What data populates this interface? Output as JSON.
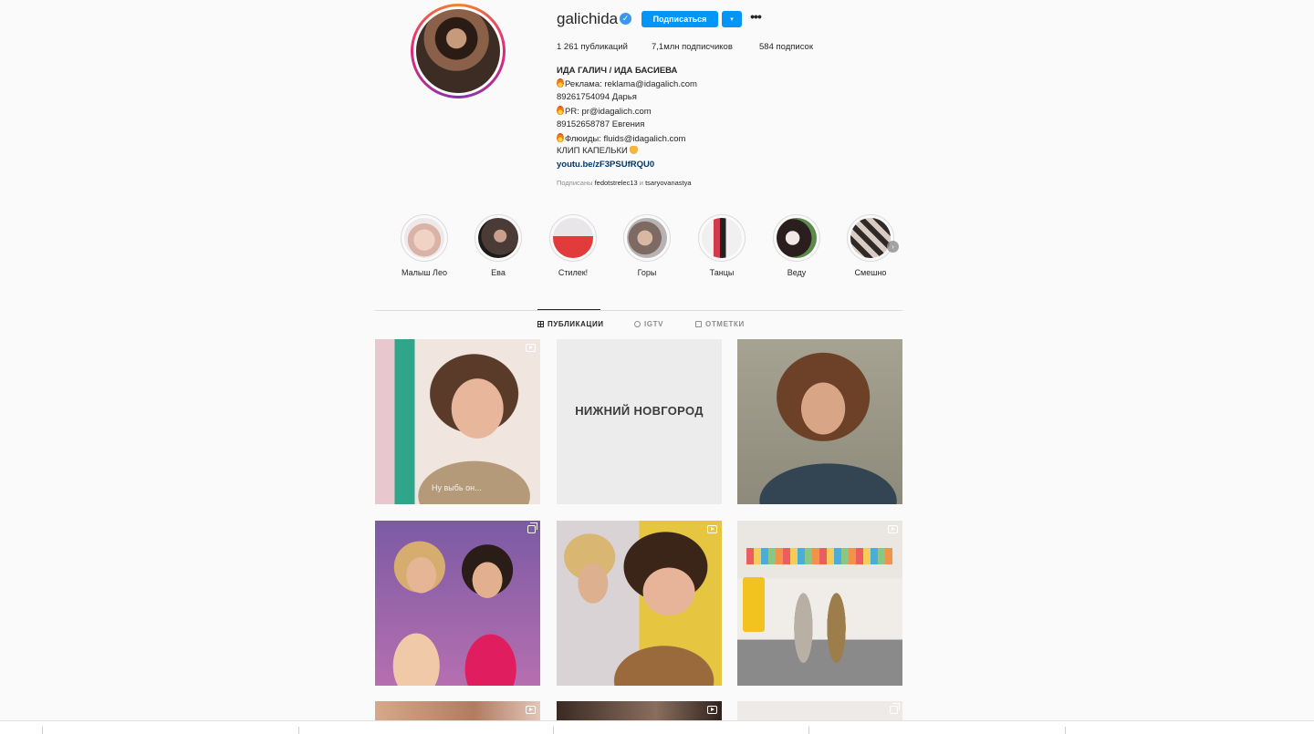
{
  "profile": {
    "username": "galichida",
    "verified_glyph": "✓",
    "follow_label": "Подписаться",
    "dropdown_glyph": "▾",
    "more_glyph": "•••",
    "stats": {
      "posts": "1 261 публикаций",
      "followers": "7,1млн подписчиков",
      "following": "584 подписок"
    },
    "bio": {
      "name": "ИДА ГАЛИЧ / ИДА БАСИЕВА",
      "line1": "Реклама: reklama@idagalich.com",
      "line2": "89261754094 Дарья",
      "line3": "PR: pr@idagalich.com",
      "line4": "89152658787 Евгения",
      "line5": "Флюиды: fluids@idagalich.com",
      "line6": "КЛИП КАПЕЛЬКИ",
      "link": "youtu.be/zF3PSUfRQU0"
    },
    "followed_by": {
      "prefix": "Подписаны",
      "user1": "fedotstrelec13",
      "and": "и",
      "user2": "tsaryovanastya"
    }
  },
  "highlights": [
    {
      "label": "Малыш Лео"
    },
    {
      "label": "Ева"
    },
    {
      "label": "Стилек!"
    },
    {
      "label": "Горы"
    },
    {
      "label": "Танцы"
    },
    {
      "label": "Веду"
    },
    {
      "label": "Смешно"
    }
  ],
  "highlights_next_glyph": "›",
  "tabs": {
    "posts": "ПУБЛИКАЦИИ",
    "igtv": "IGTV",
    "tagged": "ОТМЕТКИ"
  },
  "posts": {
    "p1_caption": "Ну выбь он...",
    "p2_text": "НИЖНИЙ НОВГОРОД"
  },
  "colors": {
    "accent": "#0095f6",
    "text": "#262626",
    "muted": "#8e8e8e",
    "background": "#fafafa"
  }
}
